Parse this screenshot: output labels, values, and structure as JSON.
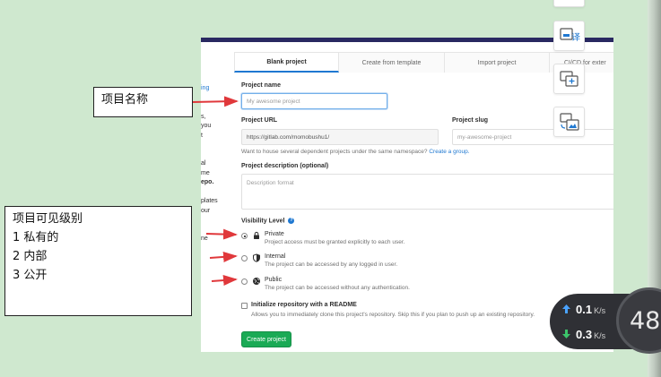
{
  "tabs": [
    {
      "label": "Blank project"
    },
    {
      "label": "Create from template"
    },
    {
      "label": "Import project"
    },
    {
      "label": "CI/CD for exter"
    }
  ],
  "left_clip": {
    "lines": [
      "ing",
      "",
      "",
      "s,",
      "you",
      "t",
      "",
      "",
      "al",
      "me",
      "epo.",
      "",
      "plates",
      "our",
      "",
      "",
      "ne"
    ]
  },
  "form": {
    "project_name_label": "Project name",
    "project_name_placeholder": "My awesome project",
    "project_url_label": "Project URL",
    "project_url_value": "https://gitlab.com/momobushu1/",
    "project_slug_label": "Project slug",
    "project_slug_placeholder": "my-awesome-project",
    "namespace_help": "Want to house several dependent projects under the same namespace?",
    "create_group_link": "Create a group.",
    "description_label": "Project description (optional)",
    "description_placeholder": "Description format",
    "visibility_label": "Visibility Level",
    "help_glyph": "?",
    "visibility": [
      {
        "title": "Private",
        "desc": "Project access must be granted explicitly to each user.",
        "checked": true,
        "icon": "lock-icon"
      },
      {
        "title": "Internal",
        "desc": "The project can be accessed by any logged in user.",
        "checked": false,
        "icon": "shield-icon"
      },
      {
        "title": "Public",
        "desc": "The project can be accessed without any authentication.",
        "checked": false,
        "icon": "globe-icon"
      }
    ],
    "readme_label": "Initialize repository with a README",
    "readme_desc": "Allows you to immediately clone this project's repository. Skip this if you plan to push up an existing repository.",
    "create_button": "Create project"
  },
  "annotations": {
    "name_note": "项目名称",
    "visibility_note": [
      "项目可见级别",
      "1 私有的",
      "2 内部",
      "3 公开"
    ]
  },
  "network": {
    "upload": "0.1",
    "download": "0.3",
    "unit": "K/s",
    "gauge": "48"
  },
  "colors": {
    "accent": "#1f78d1",
    "create_button": "#1aaa55",
    "arrow": "#e0383b",
    "topbar": "#292961"
  }
}
